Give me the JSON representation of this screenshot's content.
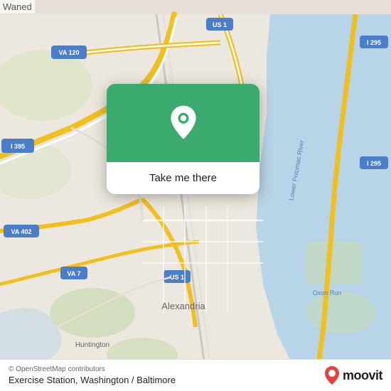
{
  "map": {
    "background_color": "#e8e0d8",
    "water_color": "#b8d4e8",
    "road_color_primary": "#f5c842",
    "road_color_secondary": "#ffffff",
    "road_color_highway": "#f5c842"
  },
  "header": {
    "waned_label": "Waned"
  },
  "popup": {
    "button_label": "Take me there",
    "icon_name": "location-pin-icon"
  },
  "bottom_bar": {
    "attribution": "© OpenStreetMap contributors",
    "location_title": "Exercise Station, Washington / Baltimore",
    "logo_text": "moovit"
  },
  "road_labels": [
    "VA 120",
    "US 1",
    "I 395",
    "I 295",
    "VA 402",
    "VA 7",
    "US 1",
    "I 295",
    "Oxon Run",
    "Alexandria",
    "Huntington",
    "Lower Potomac River"
  ]
}
